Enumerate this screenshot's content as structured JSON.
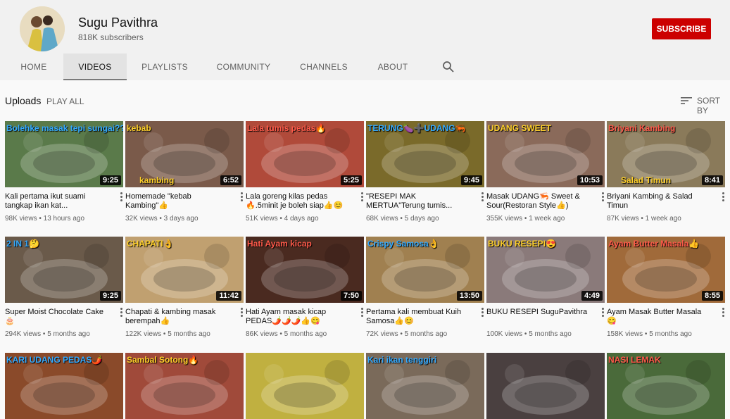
{
  "channel": {
    "name": "Sugu Pavithra",
    "subscribers": "818K subscribers",
    "subscribe_label": "SUBSCRIBE"
  },
  "tabs": [
    {
      "label": "HOME"
    },
    {
      "label": "VIDEOS"
    },
    {
      "label": "PLAYLISTS"
    },
    {
      "label": "COMMUNITY"
    },
    {
      "label": "CHANNELS"
    },
    {
      "label": "ABOUT"
    }
  ],
  "uploads": {
    "label": "Uploads",
    "play_all": "PLAY ALL",
    "sort_by": "SORT BY"
  },
  "icons": {
    "tab_search": "search-icon",
    "sort": "sort-icon"
  },
  "colors": {
    "brand_red": "#cc0000"
  },
  "videos": [
    {
      "title": "Kali pertama ikut suami tangkap ikan kat...",
      "meta": "98K views • 13 hours ago",
      "duration": "9:25",
      "thumb_text": "Bolehke masak tepi sungai??🤔",
      "thumb_color": "#5a7a4a"
    },
    {
      "title": "Homemade \"kebab Kambing\"👍",
      "meta": "32K views • 3 days ago",
      "duration": "6:52",
      "thumb_text": "kebab",
      "thumb_text2": "kambing",
      "thumb_color": "#7a5a4a"
    },
    {
      "title": "Lala goreng kilas pedas 🔥.5minit je boleh siap👍😊",
      "meta": "51K views • 4 days ago",
      "duration": "5:25",
      "thumb_text": "Lala tumis pedas🔥",
      "thumb_color": "#b04a3a"
    },
    {
      "title": "\"RESEPI MAK MERTUA\"Terung tumis...",
      "meta": "68K views • 5 days ago",
      "duration": "9:45",
      "thumb_text": "TERUNG🍆➕UDANG🦐",
      "thumb_color": "#7a6a2a"
    },
    {
      "title": "Masak UDANG🦐 Sweet & Sour(Restoran Style👍)",
      "meta": "355K views • 1 week ago",
      "duration": "10:53",
      "thumb_text": "UDANG SWEET",
      "thumb_color": "#8a6a5a"
    },
    {
      "title": "Briyani Kambing & Salad Timun",
      "meta": "87K views • 1 week ago",
      "duration": "8:41",
      "thumb_text": "Briyani Kambing",
      "thumb_text2": "Salad Timun",
      "thumb_color": "#8a7a5a"
    },
    {
      "title": "Super Moist Chocolate Cake 🎂",
      "meta": "294K views • 5 months ago",
      "duration": "9:25",
      "thumb_text": "2 IN 1🤔",
      "thumb_color": "#6a5a4a"
    },
    {
      "title": "Chapati & kambing masak berempah👍",
      "meta": "122K views • 5 months ago",
      "duration": "11:42",
      "thumb_text": "CHAPATI👌",
      "thumb_color": "#c0a070"
    },
    {
      "title": "Hati Ayam masak kicap PEDAS🌶️🌶️🌶️👍😋",
      "meta": "86K views • 5 months ago",
      "duration": "7:50",
      "thumb_text": "Hati Ayam kicap",
      "thumb_color": "#4a2a20"
    },
    {
      "title": "Pertama kali membuat Kuih Samosa👍😊",
      "meta": "72K views • 5 months ago",
      "duration": "13:50",
      "thumb_text": "Crispy Samosa👌",
      "thumb_color": "#a08050"
    },
    {
      "title": "BUKU RESEPI SuguPavithra",
      "meta": "100K views • 5 months ago",
      "duration": "4:49",
      "thumb_text": "BUKU RESEPI😍",
      "thumb_color": "#8a7a7a"
    },
    {
      "title": "Ayam Masak Butter Masala 😋",
      "meta": "158K views • 5 months ago",
      "duration": "8:55",
      "thumb_text": "Ayam Butter Masala👍",
      "thumb_color": "#a06a3a"
    },
    {
      "title": "",
      "meta": "",
      "duration": "",
      "thumb_text": "KARI UDANG PEDAS🌶️",
      "thumb_color": "#8a4a2a"
    },
    {
      "title": "",
      "meta": "",
      "duration": "",
      "thumb_text": "Sambal Sotong🔥",
      "thumb_color": "#a04a3a"
    },
    {
      "title": "",
      "meta": "",
      "duration": "",
      "thumb_text": "",
      "thumb_color": "#c0b040"
    },
    {
      "title": "",
      "meta": "",
      "duration": "",
      "thumb_text": "Kari ikan tenggiri",
      "thumb_color": "#7a6a5a"
    },
    {
      "title": "",
      "meta": "",
      "duration": "",
      "thumb_text": "",
      "thumb_color": "#4a4040"
    },
    {
      "title": "",
      "meta": "",
      "duration": "",
      "thumb_text": "NASI LEMAK",
      "thumb_color": "#4a6a3a"
    }
  ]
}
